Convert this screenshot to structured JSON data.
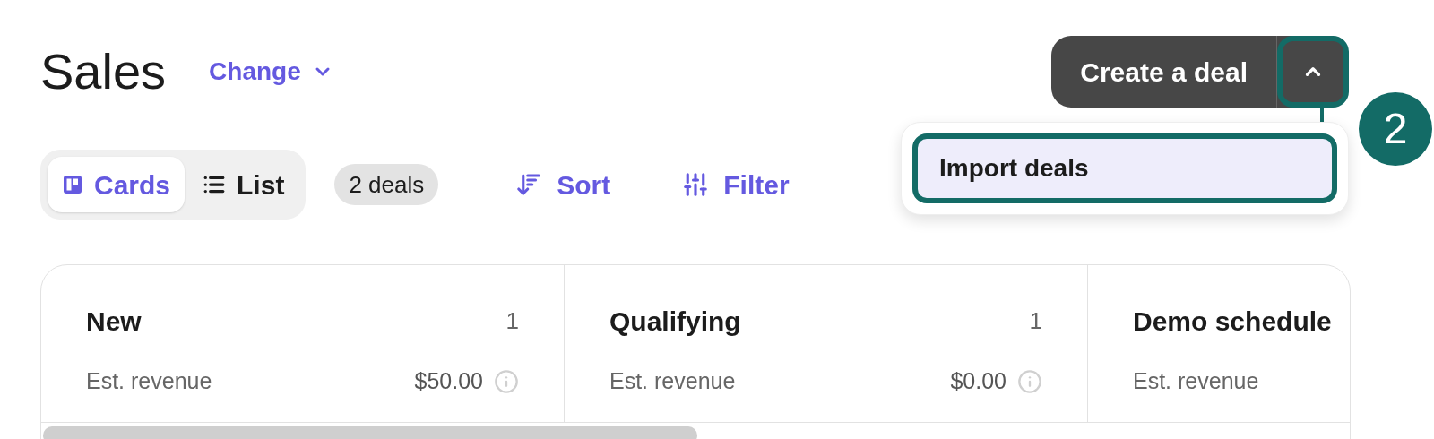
{
  "header": {
    "title": "Sales",
    "change_link": "Change"
  },
  "views": [
    {
      "label": "Cards",
      "kind": "cards",
      "selected": true
    },
    {
      "label": "List",
      "kind": "list",
      "selected": false
    }
  ],
  "deal_count": "2 deals",
  "toolbar": [
    {
      "label": "Sort",
      "kind": "sort"
    },
    {
      "label": "Filter",
      "kind": "filter"
    }
  ],
  "create_button": {
    "label": "Create a deal",
    "menu_expanded": true
  },
  "menu": {
    "items": [
      {
        "label": "Import deals",
        "selected": true
      }
    ]
  },
  "annotation": {
    "number": "2"
  },
  "columns": [
    {
      "name": "New",
      "count": "1",
      "revenue_label": "Est. revenue",
      "revenue": "$50.00"
    },
    {
      "name": "Qualifying",
      "count": "1",
      "revenue_label": "Est. revenue",
      "revenue": "$0.00"
    },
    {
      "name": "Demo schedule",
      "revenue_label": "Est. revenue"
    }
  ]
}
